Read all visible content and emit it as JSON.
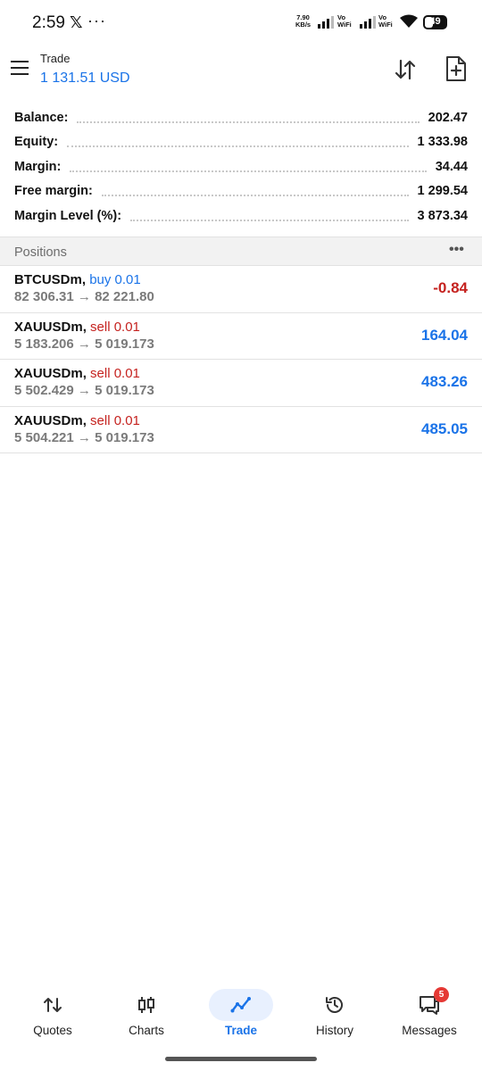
{
  "status_bar": {
    "time": "2:59",
    "x_glyph": "𝕏",
    "overflow_dots": "···",
    "net_speed_value": "7.90",
    "net_speed_unit": "KB/s",
    "vowifi_top": "Vo",
    "vowifi_bottom": "WiFi",
    "battery": "49"
  },
  "header": {
    "title": "Trade",
    "balance": "1 131.51 USD"
  },
  "summary": [
    {
      "label": "Balance:",
      "value": "202.47"
    },
    {
      "label": "Equity:",
      "value": "1 333.98"
    },
    {
      "label": "Margin:",
      "value": "34.44"
    },
    {
      "label": "Free margin:",
      "value": "1 299.54"
    },
    {
      "label": "Margin Level (%):",
      "value": "3 873.34"
    }
  ],
  "positions": {
    "title": "Positions",
    "more": "•••",
    "items": [
      {
        "symbol": "BTCUSDm",
        "separator": ",",
        "type": "buy 0.01",
        "prices": "82 306.31 → 82 221.80",
        "profit": "-0.84"
      },
      {
        "symbol": "XAUUSDm",
        "separator": ",",
        "type": "sell 0.01",
        "prices": "5 183.206 → 5 019.173",
        "profit": "164.04"
      },
      {
        "symbol": "XAUUSDm",
        "separator": ",",
        "type": "sell 0.01",
        "prices": "5 502.429 → 5 019.173",
        "profit": "483.26"
      },
      {
        "symbol": "XAUUSDm",
        "separator": ",",
        "type": "sell 0.01",
        "prices": "5 504.221 → 5 019.173",
        "profit": "485.05"
      }
    ]
  },
  "nav": {
    "items": [
      {
        "label": "Quotes",
        "icon": "quotes-icon"
      },
      {
        "label": "Charts",
        "icon": "candlestick-icon"
      },
      {
        "label": "Trade",
        "icon": "trade-line-icon",
        "active": true
      },
      {
        "label": "History",
        "icon": "history-icon"
      },
      {
        "label": "Messages",
        "icon": "messages-icon",
        "badge": "5"
      }
    ]
  },
  "colors": {
    "accent": "#1a73e8",
    "loss": "#c5221f",
    "badge": "#e53935",
    "section_bg": "#f2f2f2"
  }
}
